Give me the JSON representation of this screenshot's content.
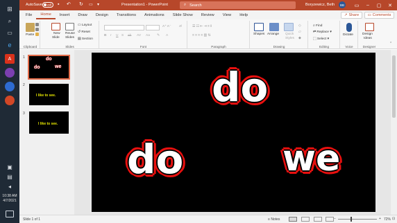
{
  "taskbar": {
    "time": "10:38 AM",
    "date": "4/7/2021"
  },
  "titlebar": {
    "autosave_label": "AutoSave",
    "autosave_state": "Off",
    "document_title": "Presentation1 - PowerPoint",
    "search_placeholder": "Search",
    "user_name": "Boryzewicz, Beth",
    "user_initials": "BB"
  },
  "tabs": [
    "File",
    "Home",
    "Insert",
    "Draw",
    "Design",
    "Transitions",
    "Animations",
    "Slide Show",
    "Review",
    "View",
    "Help"
  ],
  "actions": {
    "share": "Share",
    "comments": "Comments"
  },
  "ribbon": {
    "clipboard": {
      "paste": "Paste",
      "label": "Clipboard"
    },
    "slides": {
      "new_slide_1": "New",
      "new_slide_2": "Slide",
      "reuse_1": "Reuse",
      "reuse_2": "Slides",
      "layout": "Layout",
      "reset": "Reset",
      "section": "Section",
      "label": "Slides"
    },
    "font": {
      "label": "Font"
    },
    "paragraph": {
      "label": "Paragraph"
    },
    "drawing": {
      "shapes": "Shapes",
      "arrange": "Arrange",
      "quick_styles_1": "Quick",
      "quick_styles_2": "Styles",
      "label": "Drawing"
    },
    "editing": {
      "find": "Find",
      "replace": "Replace",
      "select": "Select",
      "label": "Editing"
    },
    "voice": {
      "dictate": "Dictate",
      "label": "Voice"
    },
    "designer": {
      "ideas_1": "Design",
      "ideas_2": "Ideas",
      "label": "Designer"
    }
  },
  "thumbnails": [
    {
      "number": "1",
      "words": [
        "do",
        "do",
        "we"
      ]
    },
    {
      "number": "2",
      "strip": "I like to see."
    },
    {
      "number": "3",
      "strip": "I like to see."
    }
  ],
  "slide": {
    "words": [
      "do",
      "do",
      "we"
    ]
  },
  "statusbar": {
    "slide_info": "Slide 1 of 1",
    "notes": "Notes",
    "zoom": "72%",
    "zoom_level": 0.72
  },
  "colors": {
    "accent": "#b7472a",
    "outline": "#e8100f",
    "slide_bg": "#000000"
  }
}
